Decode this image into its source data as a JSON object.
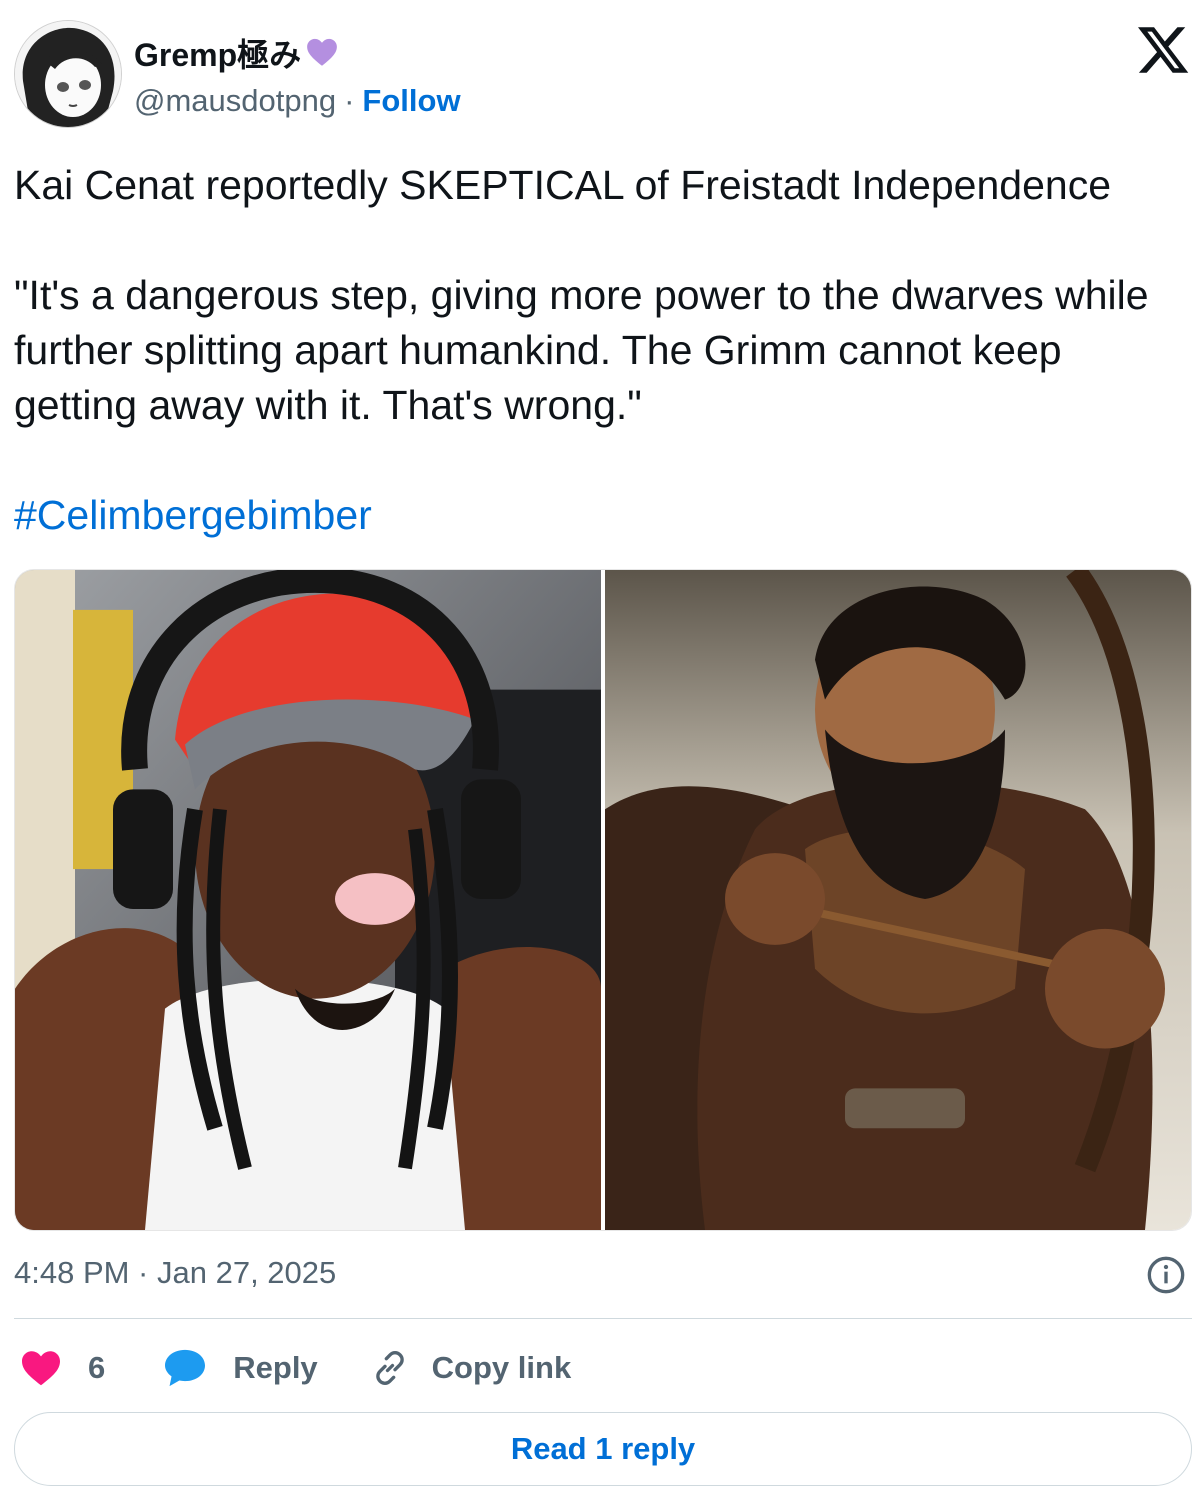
{
  "author": {
    "display_name": "Gremp極み",
    "handle": "@mausdotpng",
    "separator": "·",
    "follow_label": "Follow",
    "badge_icon": "purple-heart-icon",
    "badge_color": "#b48fe0"
  },
  "tweet": {
    "line1": "Kai Cenat reportedly SKEPTICAL of Freistadt Independence",
    "quote": "\"It's a dangerous step, giving more power to the dwarves while further splitting apart humankind. The Grimm cannot keep getting away with it. That's wrong.\"",
    "hashtag": "#Celimbergebimber"
  },
  "timestamp": "4:48 PM · Jan 27, 2025",
  "actions": {
    "like_count": "6",
    "reply_label": "Reply",
    "copy_label": "Copy link"
  },
  "read_replies_label": "Read 1 reply",
  "colors": {
    "accent": "#006fd6",
    "like": "#f91880",
    "reply_bubble": "#1d9bf0",
    "muted": "#536471"
  }
}
